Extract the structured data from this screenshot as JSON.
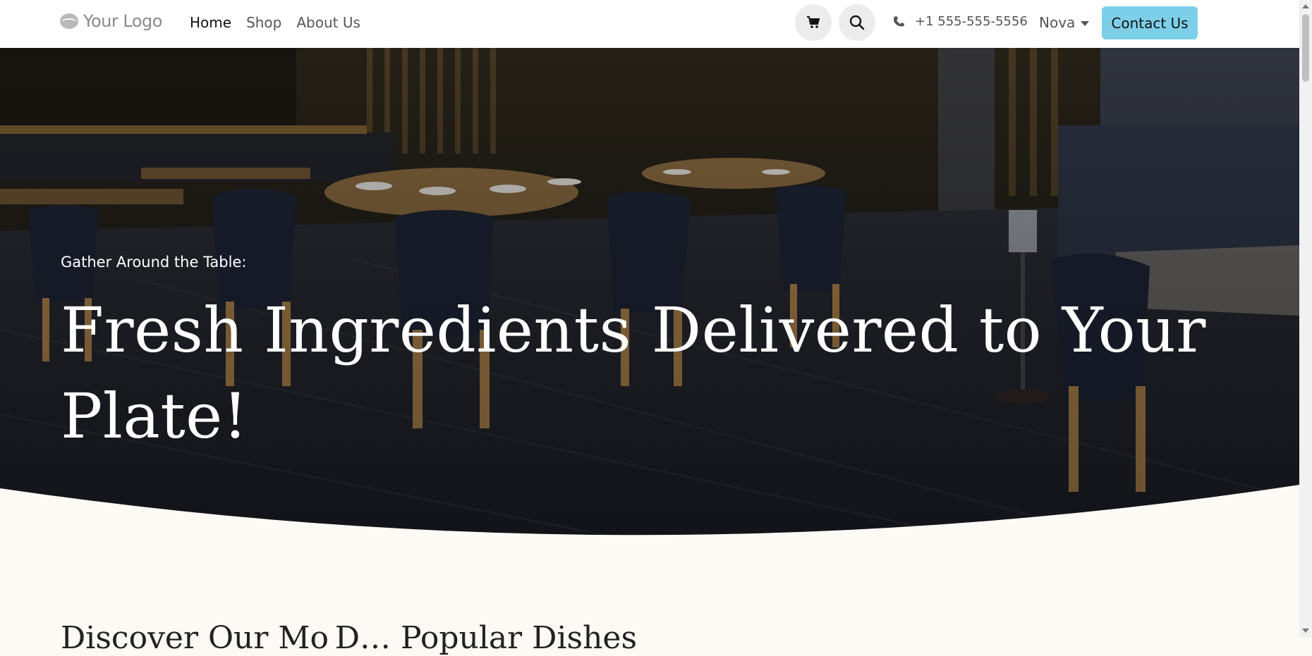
{
  "header": {
    "logo_text": "Your Logo",
    "nav": [
      {
        "label": "Home",
        "active": true
      },
      {
        "label": "Shop",
        "active": false
      },
      {
        "label": "About Us",
        "active": false
      }
    ],
    "cart_icon": "cart-icon",
    "search_icon": "search-icon",
    "phone_icon": "phone-icon",
    "phone": "+1 555-555-5556",
    "user_name": "Nova",
    "contact_button": "Contact Us"
  },
  "hero": {
    "subtitle": "Gather Around the Table:",
    "title": "Fresh Ingredients Delivered to Your Plate!"
  },
  "section": {
    "heading": "Discover Our Mo D… Popular Dishes"
  },
  "colors": {
    "accent": "#7dcfe9",
    "page_bg": "#fdf9f4",
    "header_bg": "#ffffff"
  }
}
